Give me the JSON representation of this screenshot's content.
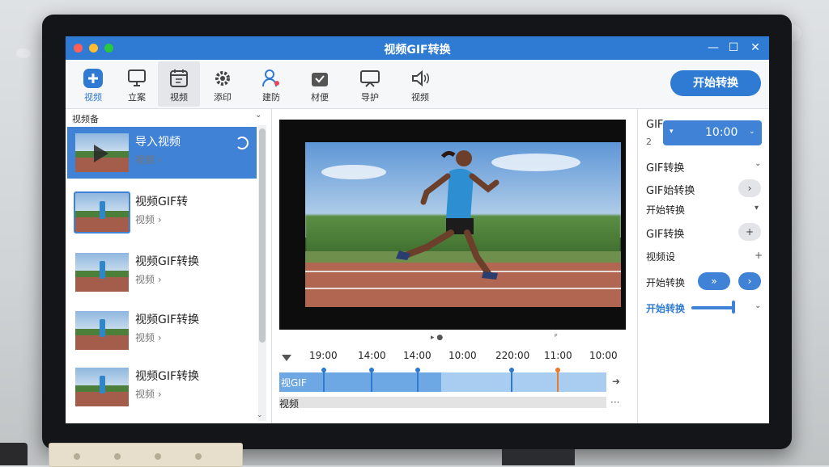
{
  "window": {
    "title": "视频GIF转换",
    "controls": [
      "—",
      "☐",
      "✕"
    ]
  },
  "toolbar": {
    "tools": [
      {
        "label": "视频",
        "icon": "plus-icon"
      },
      {
        "label": "立案",
        "icon": "monitor-icon"
      },
      {
        "label": "视频",
        "icon": "calendar-icon"
      },
      {
        "label": "添印",
        "icon": "gear-icon"
      },
      {
        "label": "建防",
        "icon": "user-icon"
      },
      {
        "label": "材便",
        "icon": "box-icon"
      },
      {
        "label": "导护",
        "icon": "tv-icon"
      },
      {
        "label": "视频",
        "icon": "speaker-icon"
      }
    ],
    "start_button": "开始转换"
  },
  "left_panel": {
    "header": "视频备",
    "items": [
      {
        "title": "导入视频",
        "sub": "视频 ›",
        "selected": true
      },
      {
        "title": "视频GIF转",
        "sub": "视频 ›",
        "selected": false
      },
      {
        "title": "视频GIF转换",
        "sub": "视频 ›",
        "selected": false
      },
      {
        "title": "视频GIF转换",
        "sub": "视频 ›",
        "selected": false
      },
      {
        "title": "视频GIF转换",
        "sub": "视频 ›",
        "selected": false
      }
    ]
  },
  "player": {
    "mini_controls": [
      "▸ ●",
      "ᴾ"
    ],
    "ruler_labels": [
      "19:00",
      "14:00",
      "14:00",
      "10:00",
      "220:00",
      "11:00",
      "10:00"
    ],
    "timeline_label": "视GIF",
    "audio_label": "视频",
    "more": "···",
    "arrow": "➜"
  },
  "right_panel": {
    "label_top": "GIF",
    "label_top_sub": "2",
    "time_value": "10:00",
    "rows": [
      {
        "label": "GIF转换",
        "action": "⌄"
      },
      {
        "label": "GIF始转换",
        "action": "›"
      },
      {
        "label": "开始转换",
        "action": "▾"
      },
      {
        "label": "GIF转换",
        "action": "+"
      },
      {
        "label": "视频设",
        "action": "+"
      },
      {
        "label": "开始转换",
        "action": "»"
      },
      {
        "label": "开始转换",
        "action": "⌄"
      }
    ]
  },
  "colors": {
    "accent": "#2f7bd3",
    "selected": "#3f82d6",
    "marker_orange": "#ec7a2b"
  }
}
